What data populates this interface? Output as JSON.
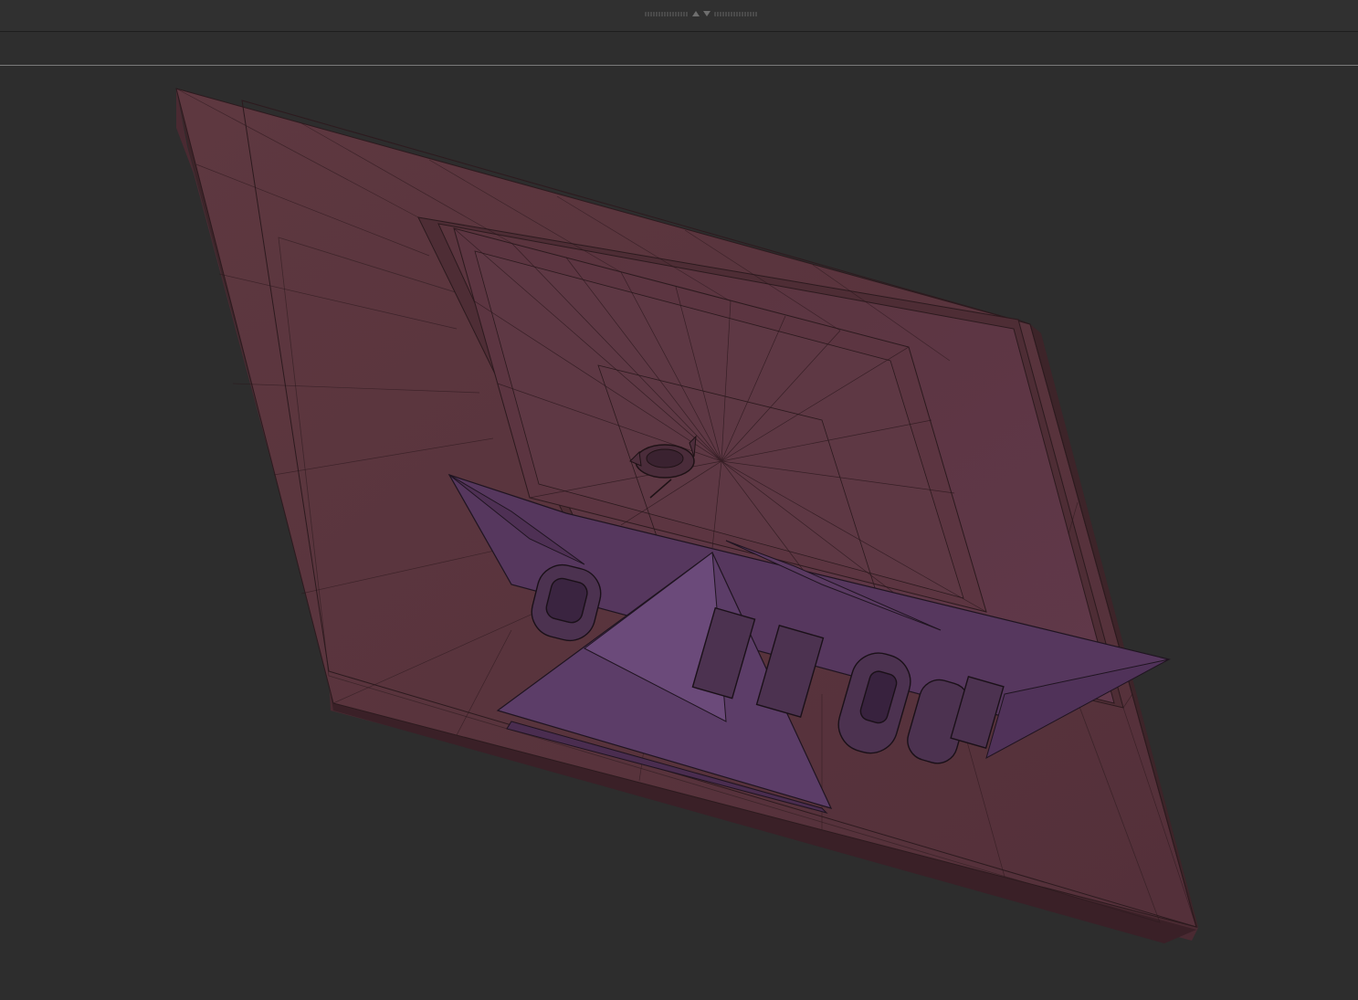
{
  "window": {
    "collapse_handle_icon": "collapse-toggle-icon"
  },
  "viewport": {
    "background_color": "#2d2d2d",
    "model_color": "#5a343c",
    "model_shadow_color": "#3d2328",
    "model_highlight_color": "#6a3e48",
    "logo_color": "#5a3a5e"
  }
}
